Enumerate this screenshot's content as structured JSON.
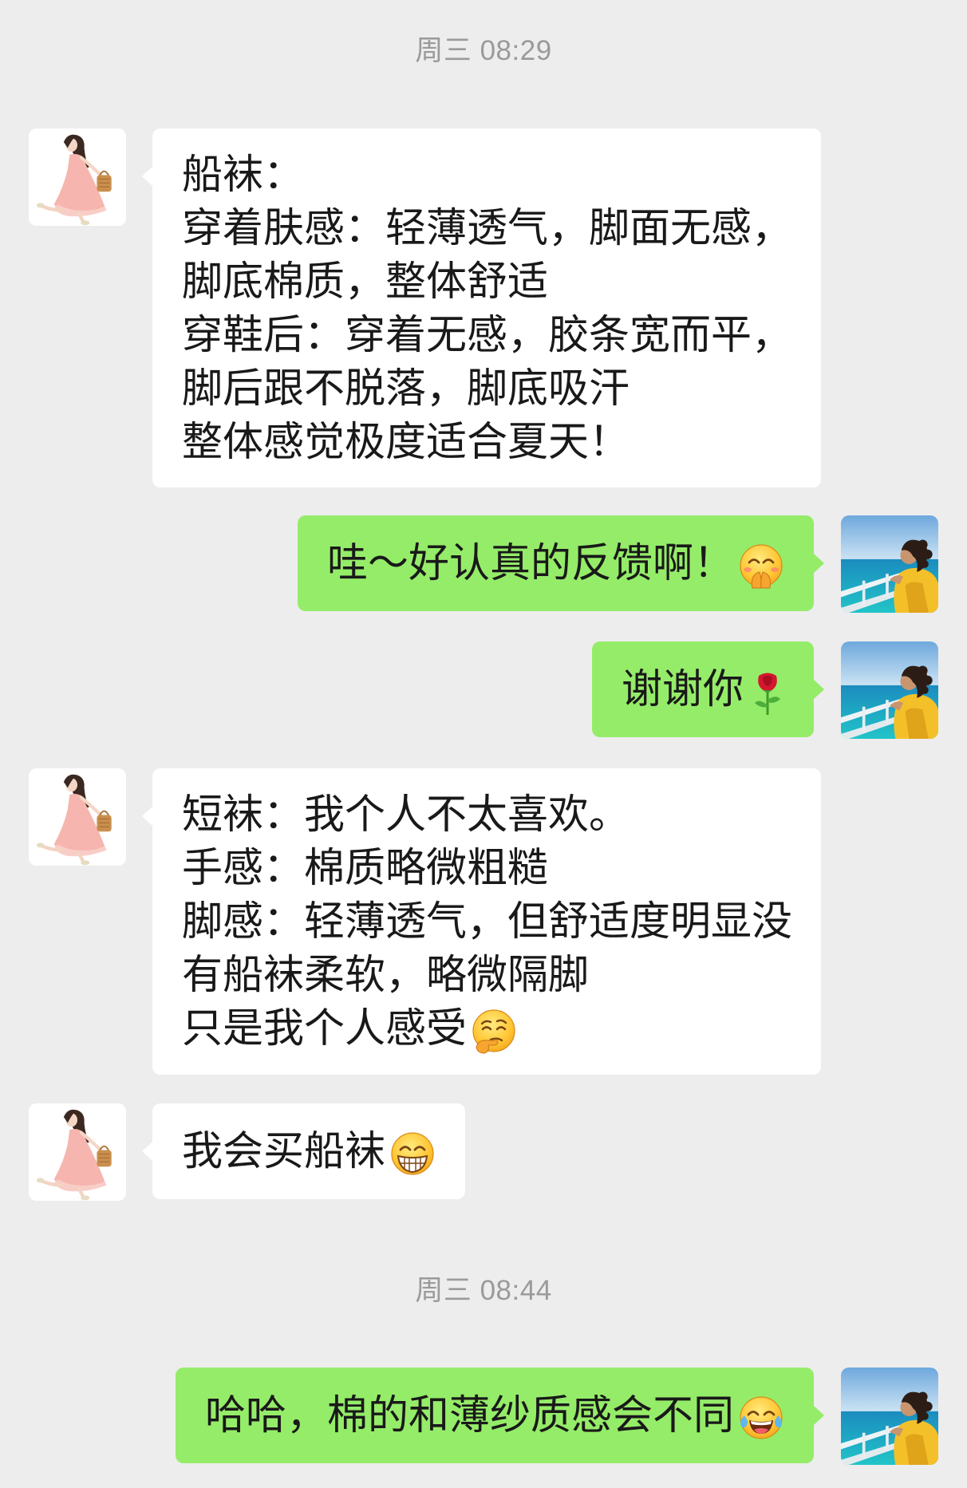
{
  "colors": {
    "background": "#ededed",
    "bubble_received": "#ffffff",
    "bubble_sent": "#95ec69",
    "text": "#191919",
    "timestamp": "#9a9a9a"
  },
  "timestamps": [
    "周三 08:29",
    "周三 08:44"
  ],
  "messages": [
    {
      "avatar": "contact-avatar",
      "lines": [
        "船袜：",
        "穿着肤感：轻薄透气，脚面无感，",
        "脚底棉质，整体舒适",
        "穿鞋后：穿着无感，胶条宽而平，",
        "脚后跟不脱落，脚底吸汗",
        "整体感觉极度适合夏天！"
      ]
    },
    {
      "avatar": "my-avatar",
      "lines": [
        "哇～好认真的反馈啊！"
      ],
      "emoji": "hand-over-mouth-emoji-icon"
    },
    {
      "avatar": "my-avatar",
      "lines": [
        "谢谢你"
      ],
      "emoji": "rose-emoji-icon"
    },
    {
      "avatar": "contact-avatar",
      "lines": [
        "短袜：我个人不太喜欢。",
        "手感：棉质略微粗糙",
        "脚感：轻薄透气，但舒适度明显没",
        "有船袜柔软，略微隔脚",
        "只是我个人感受"
      ],
      "emoji": "thinking-face-emoji-icon"
    },
    {
      "avatar": "contact-avatar",
      "lines": [
        "我会买船袜"
      ],
      "emoji": "grinning-face-emoji-icon"
    },
    {
      "avatar": "my-avatar",
      "lines": [
        "哈哈，棉的和薄纱质感会不同"
      ],
      "emoji": "tears-of-joy-emoji-icon"
    }
  ]
}
